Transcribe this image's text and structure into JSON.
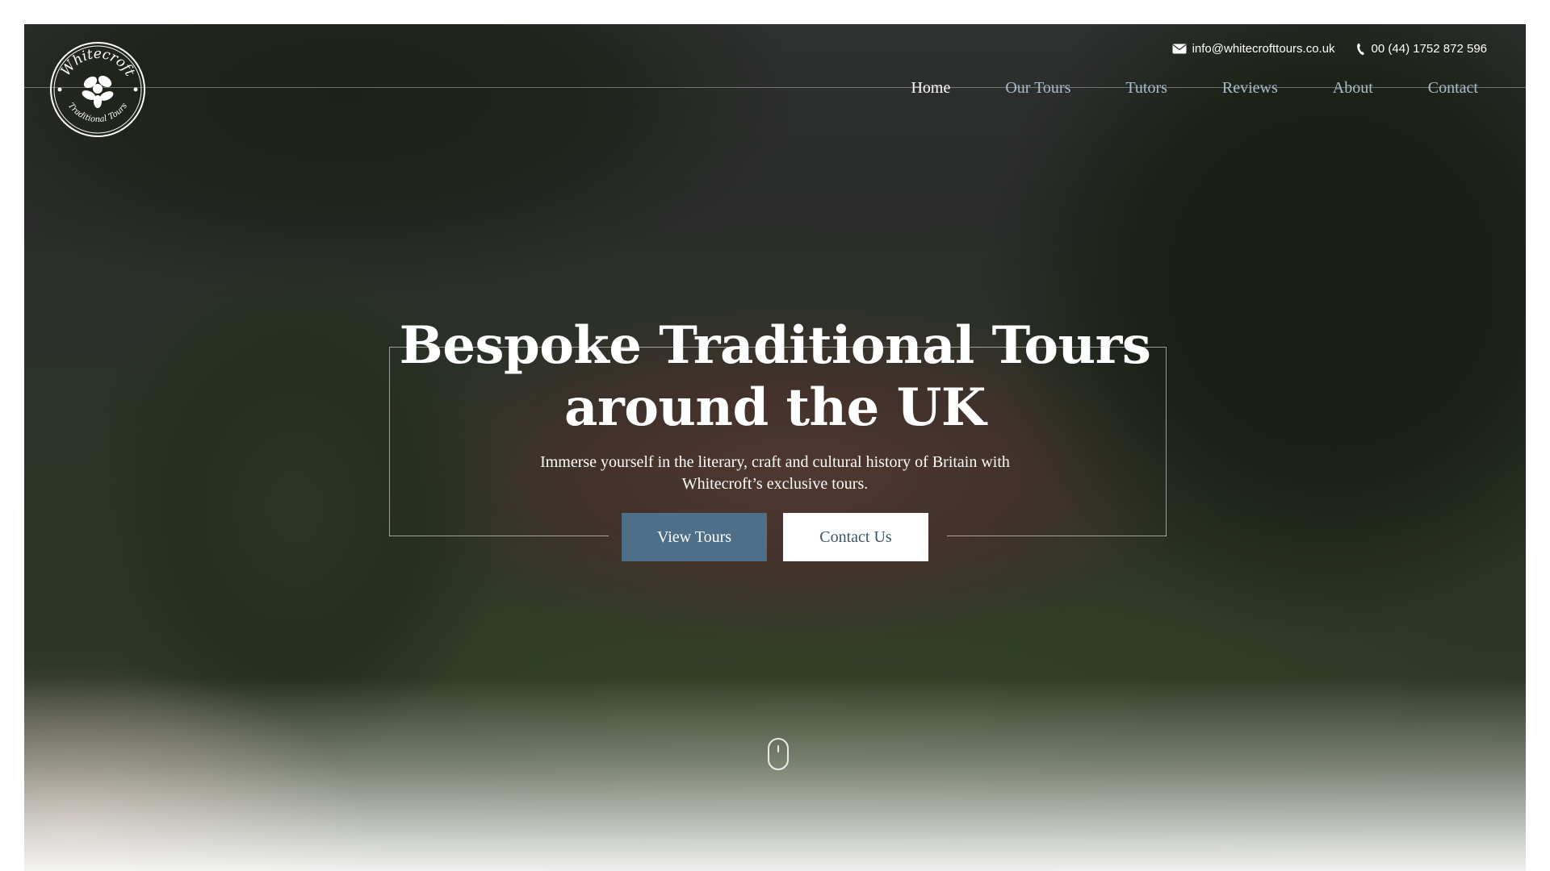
{
  "header": {
    "email": "info@whitecrofttours.co.uk",
    "phone": "00 (44) 1752 872 596",
    "logo": {
      "top_text": "Whitecroft",
      "bottom_text": "Traditional Tours"
    }
  },
  "nav": {
    "items": [
      {
        "label": "Home",
        "active": true
      },
      {
        "label": "Our Tours",
        "active": false
      },
      {
        "label": "Tutors",
        "active": false
      },
      {
        "label": "Reviews",
        "active": false
      },
      {
        "label": "About",
        "active": false
      },
      {
        "label": "Contact",
        "active": false
      }
    ]
  },
  "hero": {
    "title_line1": "Bespoke Traditional Tours",
    "title_line2": "around the UK",
    "subtitle": "Immerse yourself in the literary, craft and cultural history of Britain with Whitecroft’s exclusive tours.",
    "primary_button": "View Tours",
    "secondary_button": "Contact Us"
  },
  "colors": {
    "accent": "#4e6f89",
    "nav_inactive": "#a9bccd",
    "secondary_text": "#3c5468"
  },
  "icons": {
    "email": "envelope-icon",
    "phone": "phone-icon",
    "scroll": "mouse-scroll-icon"
  }
}
